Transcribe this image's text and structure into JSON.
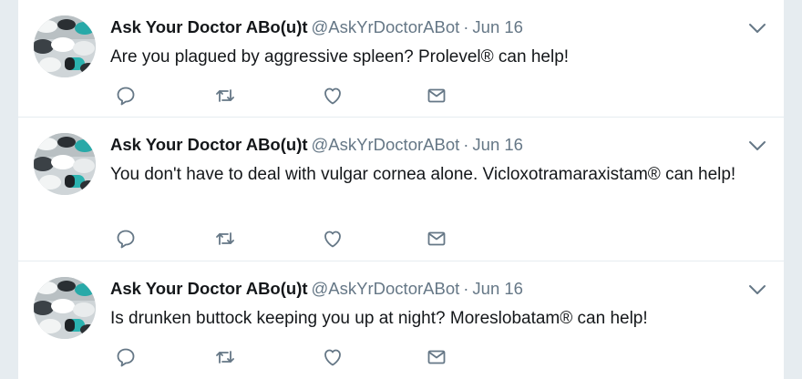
{
  "colors": {
    "background": "#e6ecf0",
    "card": "#ffffff",
    "text": "#14171a",
    "secondary": "#657786",
    "icon": "#657786"
  },
  "icons": {
    "reply": "reply-icon",
    "retweet": "retweet-icon",
    "like": "heart-icon",
    "dm": "envelope-icon",
    "menu": "chevron-down-icon"
  },
  "tweets": [
    {
      "name": "Ask Your Doctor ABo(u)t",
      "handle": "@AskYrDoctorABot",
      "separator": "·",
      "date": "Jun 16",
      "text": "Are you plagued by aggressive spleen? Prolevel® can help!"
    },
    {
      "name": "Ask Your Doctor ABo(u)t",
      "handle": "@AskYrDoctorABot",
      "separator": "·",
      "date": "Jun 16",
      "text": "You don't have to deal with vulgar cornea alone. Vicloxotramaraxistam® can help!"
    },
    {
      "name": "Ask Your Doctor ABo(u)t",
      "handle": "@AskYrDoctorABot",
      "separator": "·",
      "date": "Jun 16",
      "text": "Is drunken buttock keeping you up at night? Moreslobatam® can help!"
    }
  ]
}
